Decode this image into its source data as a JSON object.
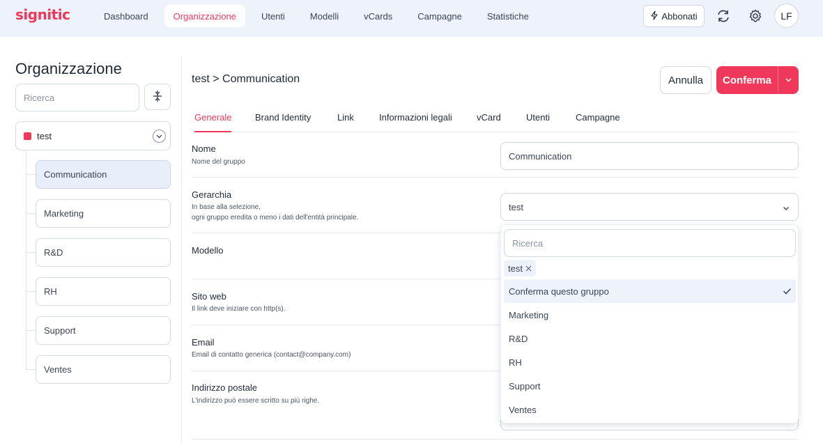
{
  "app": {
    "logo": "signitic"
  },
  "nav": {
    "items": [
      {
        "label": "Dashboard",
        "active": false
      },
      {
        "label": "Organizzazione",
        "active": true
      },
      {
        "label": "Utenti",
        "active": false
      },
      {
        "label": "Modelli",
        "active": false
      },
      {
        "label": "vCards",
        "active": false
      },
      {
        "label": "Campagne",
        "active": false
      },
      {
        "label": "Statistiche",
        "active": false
      }
    ],
    "subscribe_label": "Abbonati",
    "avatar_initials": "LF"
  },
  "sidebar": {
    "title": "Organizzazione",
    "search_placeholder": "Ricerca",
    "root": {
      "label": "test",
      "color": "#f0395a"
    },
    "children": [
      {
        "label": "Communication",
        "active": true
      },
      {
        "label": "Marketing",
        "active": false
      },
      {
        "label": "R&D",
        "active": false
      },
      {
        "label": "RH",
        "active": false
      },
      {
        "label": "Support",
        "active": false
      },
      {
        "label": "Ventes",
        "active": false
      }
    ]
  },
  "main": {
    "breadcrumb": "test > Communication",
    "cancel_label": "Annulla",
    "confirm_label": "Conferma",
    "tabs": [
      {
        "label": "Generale",
        "active": true
      },
      {
        "label": "Brand Identity",
        "active": false
      },
      {
        "label": "Link",
        "active": false
      },
      {
        "label": "Informazioni legali",
        "active": false
      },
      {
        "label": "vCard",
        "active": false
      },
      {
        "label": "Utenti",
        "active": false
      },
      {
        "label": "Campagne",
        "active": false
      }
    ],
    "fields": {
      "nome": {
        "label": "Nome",
        "desc": "Nome del gruppo",
        "value": "Communication"
      },
      "gerarchia": {
        "label": "Gerarchia",
        "desc1": "In base alla selezione,",
        "desc2": "ogni gruppo eredita o meno i dati dell'entità principale.",
        "value": "test"
      },
      "modello": {
        "label": "Modello"
      },
      "sito": {
        "label": "Sito web",
        "desc": "Il link deve iniziare con http(s)."
      },
      "email": {
        "label": "Email",
        "desc": "Email di contatto generica (contact@company.com)"
      },
      "indirizzo": {
        "label": "Indirizzo postale",
        "desc": "L'indirizzo può essere scritto su più righe."
      }
    },
    "dropdown": {
      "search_placeholder": "Ricerca",
      "chip": "test",
      "options": [
        {
          "label": "Conferma questo gruppo",
          "selected": true
        },
        {
          "label": "Marketing",
          "selected": false
        },
        {
          "label": "R&D",
          "selected": false
        },
        {
          "label": "RH",
          "selected": false
        },
        {
          "label": "Support",
          "selected": false
        },
        {
          "label": "Ventes",
          "selected": false
        }
      ]
    }
  },
  "colors": {
    "accent": "#f0395a",
    "topbar_bg": "#eef3fb",
    "active_bg": "#e8eefa"
  }
}
